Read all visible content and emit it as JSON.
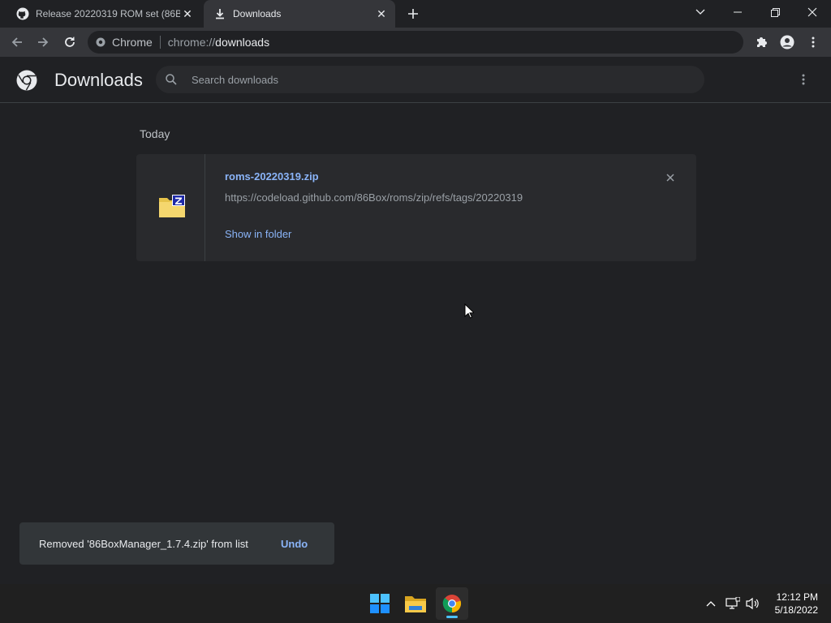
{
  "browser": {
    "tabs": [
      {
        "title": "Release 20220319 ROM set (86Bo",
        "favicon": "github-icon",
        "active": false
      },
      {
        "title": "Downloads",
        "favicon": "download-icon",
        "active": true
      }
    ],
    "omnibox": {
      "site_label": "Chrome",
      "url_scheme": "chrome://",
      "url_host": "downloads"
    }
  },
  "page": {
    "title": "Downloads",
    "search_placeholder": "Search downloads",
    "date_header": "Today",
    "items": [
      {
        "filename": "roms-20220319.zip",
        "url": "https://codeload.github.com/86Box/roms/zip/refs/tags/20220319",
        "action": "Show in folder"
      }
    ]
  },
  "toast": {
    "message": "Removed '86BoxManager_1.7.4.zip' from list",
    "action": "Undo"
  },
  "taskbar": {
    "apps": [
      "start-icon",
      "file-explorer-icon",
      "chrome-icon"
    ],
    "clock_time": "12:12 PM",
    "clock_date": "5/18/2022"
  },
  "colors": {
    "accent_link": "#8ab4f8",
    "background": "#202124",
    "card": "#292a2d"
  }
}
